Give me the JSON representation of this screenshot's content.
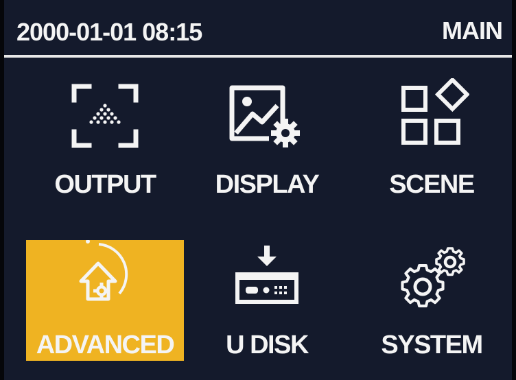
{
  "header": {
    "datetime": "2000-01-01 08:15",
    "page": "MAIN"
  },
  "menu": [
    {
      "label": "OUTPUT",
      "icon": "output-icon",
      "selected": false
    },
    {
      "label": "DISPLAY",
      "icon": "display-icon",
      "selected": false
    },
    {
      "label": "SCENE",
      "icon": "scene-icon",
      "selected": false
    },
    {
      "label": "ADVANCED",
      "icon": "advanced-icon",
      "selected": true
    },
    {
      "label": "U DISK",
      "icon": "u-disk-icon",
      "selected": false
    },
    {
      "label": "SYSTEM",
      "icon": "system-icon",
      "selected": false
    }
  ],
  "colors": {
    "background": "#141a2c",
    "foreground": "#f4f4f4",
    "selection": "#efb322"
  }
}
